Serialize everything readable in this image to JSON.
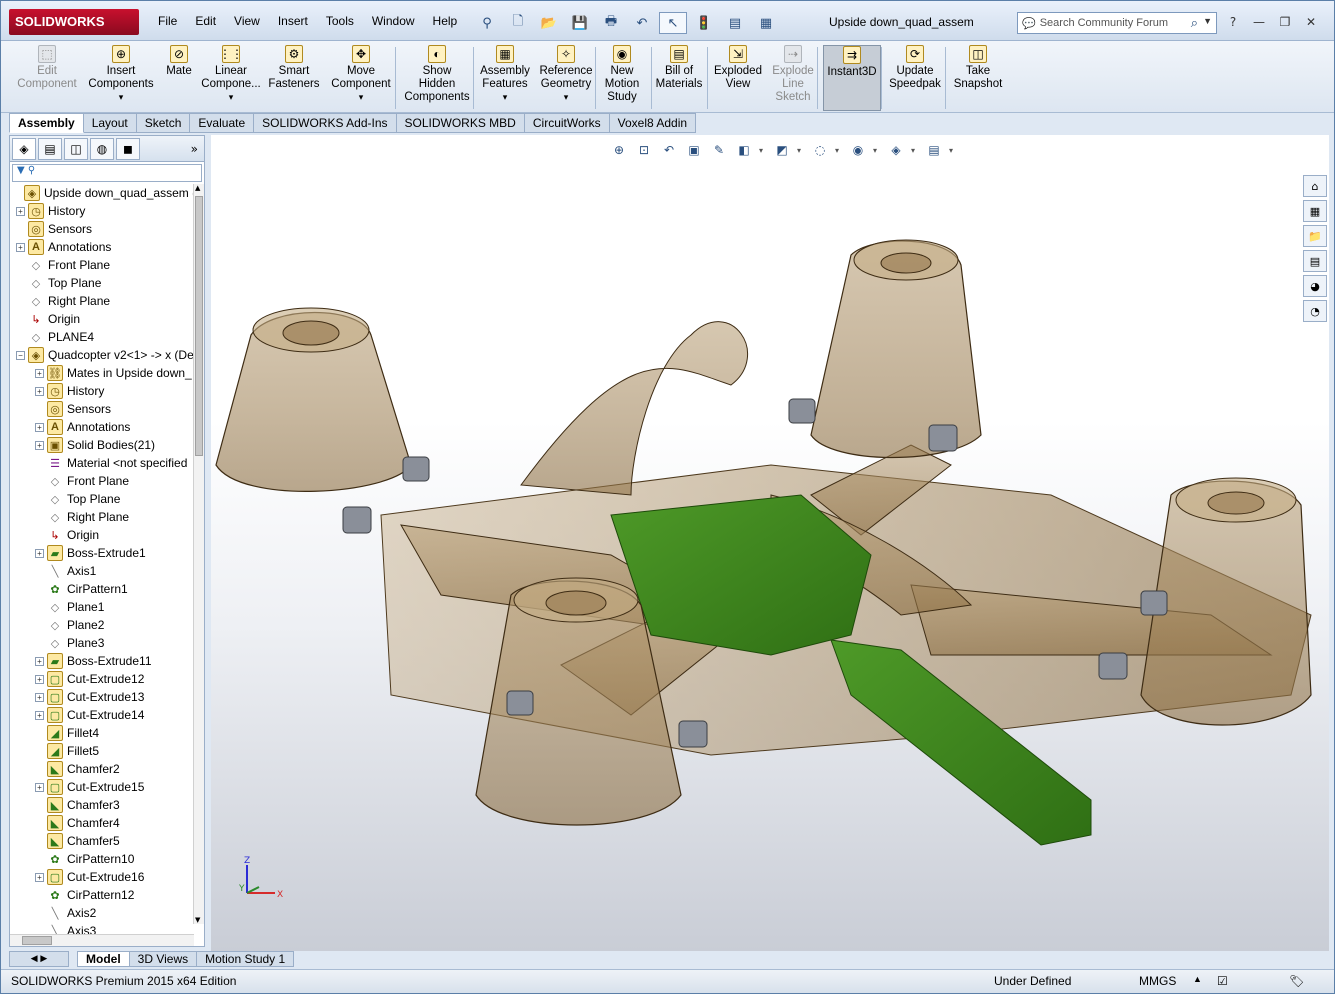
{
  "app": {
    "logo": "SOLIDWORKS",
    "document_title": "Upside down_quad_assem"
  },
  "menu": [
    "File",
    "Edit",
    "View",
    "Insert",
    "Tools",
    "Window",
    "Help"
  ],
  "quick_access": [
    {
      "icon": "pin-icon",
      "glyph": "⚲"
    },
    {
      "icon": "new-document-icon",
      "glyph": "🗋"
    },
    {
      "icon": "open-icon",
      "glyph": "📂"
    },
    {
      "icon": "save-icon",
      "glyph": "💾"
    },
    {
      "icon": "print-icon",
      "glyph": "🖶"
    },
    {
      "icon": "undo-icon",
      "glyph": "↶"
    },
    {
      "icon": "select-cursor-icon",
      "glyph": "↖"
    },
    {
      "icon": "rebuild-icon",
      "glyph": "🚦"
    },
    {
      "icon": "file-properties-icon",
      "glyph": "▤"
    },
    {
      "icon": "options-icon",
      "glyph": "▦"
    }
  ],
  "search": {
    "placeholder": "Search Community Forum"
  },
  "window_controls": {
    "help": "?",
    "minimize": "—",
    "restore": "❐",
    "close": "✕"
  },
  "command_manager": [
    {
      "label": [
        "Edit",
        "Component"
      ],
      "icon": "edit-component-icon",
      "disabled": true,
      "arrow": false
    },
    {
      "label": [
        "Insert",
        "Components"
      ],
      "icon": "insert-components-icon",
      "disabled": false,
      "arrow": true
    },
    {
      "label": [
        "Mate"
      ],
      "icon": "mate-icon",
      "disabled": false,
      "arrow": false
    },
    {
      "label": [
        "Linear",
        "Compone..."
      ],
      "icon": "linear-pattern-icon",
      "disabled": false,
      "arrow": true
    },
    {
      "label": [
        "Smart",
        "Fasteners"
      ],
      "icon": "smart-fasteners-icon",
      "disabled": false,
      "arrow": false
    },
    {
      "label": [
        "Move",
        "Component"
      ],
      "icon": "move-component-icon",
      "disabled": false,
      "arrow": true
    },
    {
      "label": [
        "Show",
        "Hidden",
        "Components"
      ],
      "icon": "show-hidden-components-icon",
      "disabled": false,
      "arrow": false
    },
    {
      "label": [
        "Assembly",
        "Features"
      ],
      "icon": "assembly-features-icon",
      "disabled": false,
      "arrow": true
    },
    {
      "label": [
        "Reference",
        "Geometry"
      ],
      "icon": "reference-geometry-icon",
      "disabled": false,
      "arrow": true
    },
    {
      "label": [
        "New",
        "Motion",
        "Study"
      ],
      "icon": "new-motion-study-icon",
      "disabled": false,
      "arrow": false
    },
    {
      "label": [
        "Bill of",
        "Materials"
      ],
      "icon": "bill-of-materials-icon",
      "disabled": false,
      "arrow": false
    },
    {
      "label": [
        "Exploded",
        "View"
      ],
      "icon": "exploded-view-icon",
      "disabled": false,
      "arrow": false
    },
    {
      "label": [
        "Explode",
        "Line",
        "Sketch"
      ],
      "icon": "explode-line-sketch-icon",
      "disabled": true,
      "arrow": false
    },
    {
      "label": [
        "Instant3D"
      ],
      "icon": "instant3d-icon",
      "disabled": false,
      "arrow": false,
      "pressed": true
    },
    {
      "label": [
        "Update",
        "Speedpak"
      ],
      "icon": "update-speedpak-icon",
      "disabled": false,
      "arrow": false
    },
    {
      "label": [
        "Take",
        "Snapshot"
      ],
      "icon": "take-snapshot-icon",
      "disabled": false,
      "arrow": false
    }
  ],
  "tabs": [
    "Assembly",
    "Layout",
    "Sketch",
    "Evaluate",
    "SOLIDWORKS Add-Ins",
    "SOLIDWORKS MBD",
    "CircuitWorks",
    "Voxel8 Addin"
  ],
  "active_tab": "Assembly",
  "panel_tabs": [
    "featuremanager-icon",
    "propertymanager-icon",
    "configurationmanager-icon",
    "dimxpert-icon",
    "display-manager-icon"
  ],
  "tree": [
    {
      "label": "Upside down_quad_assem  (D",
      "icon": "assembly-icon",
      "level": 0,
      "exp": "",
      "glyph": "◈"
    },
    {
      "label": "History",
      "icon": "history-icon",
      "level": 1,
      "exp": "+",
      "glyph": "◷"
    },
    {
      "label": "Sensors",
      "icon": "sensors-icon",
      "level": 1,
      "exp": "",
      "glyph": "◎"
    },
    {
      "label": "Annotations",
      "icon": "annotations-icon",
      "level": 1,
      "exp": "+",
      "glyph": "A"
    },
    {
      "label": "Front Plane",
      "icon": "plane-icon",
      "level": 1,
      "exp": "",
      "glyph": "◇"
    },
    {
      "label": "Top Plane",
      "icon": "plane-icon",
      "level": 1,
      "exp": "",
      "glyph": "◇"
    },
    {
      "label": "Right Plane",
      "icon": "plane-icon",
      "level": 1,
      "exp": "",
      "glyph": "◇"
    },
    {
      "label": "Origin",
      "icon": "origin-icon",
      "level": 1,
      "exp": "",
      "glyph": "↳"
    },
    {
      "label": "PLANE4",
      "icon": "plane-icon",
      "level": 1,
      "exp": "",
      "glyph": "◇"
    },
    {
      "label": "Quadcopter v2<1> -> x (De",
      "icon": "part-icon",
      "level": 1,
      "exp": "−",
      "glyph": "◈"
    },
    {
      "label": "Mates in Upside down_",
      "icon": "mates-icon",
      "level": 2,
      "exp": "+",
      "glyph": "⛓"
    },
    {
      "label": "History",
      "icon": "history-icon",
      "level": 2,
      "exp": "+",
      "glyph": "◷"
    },
    {
      "label": "Sensors",
      "icon": "sensors-icon",
      "level": 2,
      "exp": "",
      "glyph": "◎"
    },
    {
      "label": "Annotations",
      "icon": "annotations-icon",
      "level": 2,
      "exp": "+",
      "glyph": "A"
    },
    {
      "label": "Solid Bodies(21)",
      "icon": "solid-bodies-icon",
      "level": 2,
      "exp": "+",
      "glyph": "▣"
    },
    {
      "label": "Material <not specified",
      "icon": "material-icon",
      "level": 2,
      "exp": "",
      "glyph": "☰"
    },
    {
      "label": "Front Plane",
      "icon": "plane-icon",
      "level": 2,
      "exp": "",
      "glyph": "◇"
    },
    {
      "label": "Top Plane",
      "icon": "plane-icon",
      "level": 2,
      "exp": "",
      "glyph": "◇"
    },
    {
      "label": "Right Plane",
      "icon": "plane-icon",
      "level": 2,
      "exp": "",
      "glyph": "◇"
    },
    {
      "label": "Origin",
      "icon": "origin-icon",
      "level": 2,
      "exp": "",
      "glyph": "↳"
    },
    {
      "label": "Boss-Extrude1",
      "icon": "boss-extrude-icon",
      "level": 2,
      "exp": "+",
      "glyph": "▰"
    },
    {
      "label": "Axis1",
      "icon": "axis-icon",
      "level": 2,
      "exp": "",
      "glyph": "╲"
    },
    {
      "label": "CirPattern1",
      "icon": "circular-pattern-icon",
      "level": 2,
      "exp": "",
      "glyph": "✿"
    },
    {
      "label": "Plane1",
      "icon": "plane-icon",
      "level": 2,
      "exp": "",
      "glyph": "◇"
    },
    {
      "label": "Plane2",
      "icon": "plane-icon",
      "level": 2,
      "exp": "",
      "glyph": "◇"
    },
    {
      "label": "Plane3",
      "icon": "plane-icon",
      "level": 2,
      "exp": "",
      "glyph": "◇"
    },
    {
      "label": "Boss-Extrude11",
      "icon": "boss-extrude-icon",
      "level": 2,
      "exp": "+",
      "glyph": "▰"
    },
    {
      "label": "Cut-Extrude12",
      "icon": "cut-extrude-icon",
      "level": 2,
      "exp": "+",
      "glyph": "▢"
    },
    {
      "label": "Cut-Extrude13",
      "icon": "cut-extrude-icon",
      "level": 2,
      "exp": "+",
      "glyph": "▢"
    },
    {
      "label": "Cut-Extrude14",
      "icon": "cut-extrude-icon",
      "level": 2,
      "exp": "+",
      "glyph": "▢"
    },
    {
      "label": "Fillet4",
      "icon": "fillet-icon",
      "level": 2,
      "exp": "",
      "glyph": "◢"
    },
    {
      "label": "Fillet5",
      "icon": "fillet-icon",
      "level": 2,
      "exp": "",
      "glyph": "◢"
    },
    {
      "label": "Chamfer2",
      "icon": "chamfer-icon",
      "level": 2,
      "exp": "",
      "glyph": "◣"
    },
    {
      "label": "Cut-Extrude15",
      "icon": "cut-extrude-icon",
      "level": 2,
      "exp": "+",
      "glyph": "▢"
    },
    {
      "label": "Chamfer3",
      "icon": "chamfer-icon",
      "level": 2,
      "exp": "",
      "glyph": "◣"
    },
    {
      "label": "Chamfer4",
      "icon": "chamfer-icon",
      "level": 2,
      "exp": "",
      "glyph": "◣"
    },
    {
      "label": "Chamfer5",
      "icon": "chamfer-icon",
      "level": 2,
      "exp": "",
      "glyph": "◣"
    },
    {
      "label": "CirPattern10",
      "icon": "circular-pattern-icon",
      "level": 2,
      "exp": "",
      "glyph": "✿"
    },
    {
      "label": "Cut-Extrude16",
      "icon": "cut-extrude-icon",
      "level": 2,
      "exp": "+",
      "glyph": "▢"
    },
    {
      "label": "CirPattern12",
      "icon": "circular-pattern-icon",
      "level": 2,
      "exp": "",
      "glyph": "✿"
    },
    {
      "label": "Axis2",
      "icon": "axis-icon",
      "level": 2,
      "exp": "",
      "glyph": "╲"
    },
    {
      "label": "Axis3",
      "icon": "axis-icon",
      "level": 2,
      "exp": "",
      "glyph": "╲"
    }
  ],
  "heads_up_toolbar": [
    "zoom-to-fit-icon",
    "zoom-to-area-icon",
    "previous-view-icon",
    "section-view-icon",
    "dynamic-annotation-icon",
    "view-orientation-icon",
    "display-style-icon",
    "hide-show-items-icon",
    "edit-appearance-icon",
    "apply-scene-icon",
    "view-settings-icon"
  ],
  "task_pane": [
    "home-icon",
    "resources-icon",
    "design-library-icon",
    "file-explorer-icon",
    "view-palette-icon",
    "appearances-icon"
  ],
  "triad": {
    "x": "X",
    "y": "Y",
    "z": "Z"
  },
  "bottom_tabs": [
    "Model",
    "3D Views",
    "Motion Study 1"
  ],
  "active_bottom_tab": "Model",
  "status": {
    "edition": "SOLIDWORKS Premium 2015 x64 Edition",
    "state": "Under Defined",
    "units": "MMGS"
  },
  "colors": {
    "brand": "#c8102e",
    "frame_translucent": "#9a7e4f",
    "board_green": "#3c8a1e",
    "viewport_bg": "#ffffff"
  }
}
